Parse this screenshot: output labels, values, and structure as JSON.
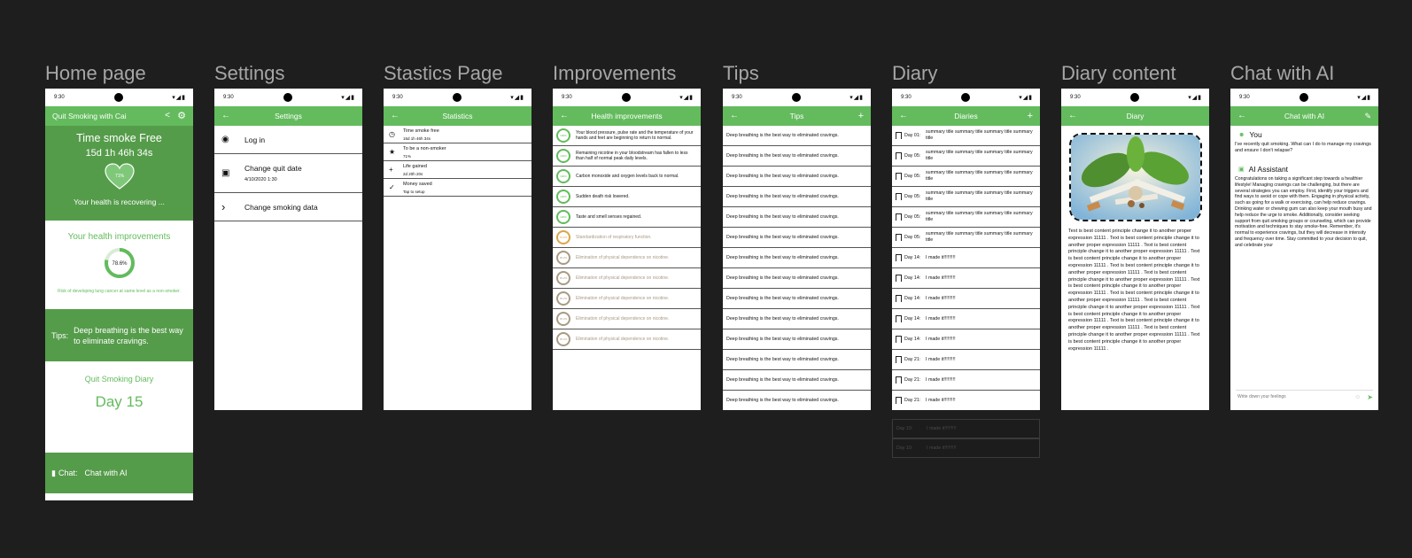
{
  "status": {
    "time": "9:30",
    "icons": "▾◢▮"
  },
  "frames": {
    "home": {
      "title": "Home page"
    },
    "settings": {
      "title": "Settings"
    },
    "stats": {
      "title": "Stastics Page"
    },
    "improvements": {
      "title": "Improvements"
    },
    "tips": {
      "title": "Tips"
    },
    "diary": {
      "title": "Diary"
    },
    "diary_content": {
      "title": "Diary content"
    },
    "chat": {
      "title": "Chat with AI"
    }
  },
  "home": {
    "app_title": "Quit Smoking with Cai",
    "smoke_free_label": "Time smoke Free",
    "smoke_free_time": "15d 1h 46h 34s",
    "heart_percent": "71%",
    "recovering": "Your health is recovering ...",
    "improvements_title": "Your health improvements",
    "improvement_percent": "78.6%",
    "improvement_progress": 0.786,
    "improvement_caption": "Risk of developing lung cancer at same level as a non-smoker.",
    "tips_label": "Tips:",
    "tips_text": "Deep breathing is the best way to eliminate cravings.",
    "diary_title": "Quit Smoking Diary",
    "diary_day": "Day 15",
    "chat_label": "Chat:",
    "chat_link": "Chat with AI"
  },
  "settings": {
    "title": "Settings",
    "items": [
      {
        "label": "Log in",
        "sub": "",
        "icon": "account-circle-icon",
        "glyph": "◉"
      },
      {
        "label": "Change quit date",
        "sub": "4/10/2020 1:30",
        "icon": "calendar-icon",
        "glyph": "▣"
      },
      {
        "label": "Change smoking data",
        "sub": "",
        "icon": "chevron-right-icon",
        "glyph": "›"
      }
    ]
  },
  "stats": {
    "title": "Statistics",
    "items": [
      {
        "label": "Time smoke free",
        "sub": "15d 1h 46h 34s",
        "icon": "clock-icon",
        "glyph": "◷"
      },
      {
        "label": "To be a non-smoker",
        "sub": "71%",
        "icon": "star-icon",
        "glyph": "★"
      },
      {
        "label": "Life gained",
        "sub": "2d 20h 20s",
        "icon": "plus-icon",
        "glyph": "+"
      },
      {
        "label": "Money saved",
        "sub": "Tap to setup",
        "icon": "check-icon",
        "glyph": "✓"
      }
    ]
  },
  "improvements": {
    "title": "Health improvements",
    "items": [
      {
        "text": "Your blood pressure, pulse rate and the temperature of your hands and feet are beginning to return to normal.",
        "pct": "100%",
        "state": "done"
      },
      {
        "text": "Remaining nicotine in your bloodstream has fallen to less than half of normal peak daily levels.",
        "pct": "100%",
        "state": "done"
      },
      {
        "text": "Carbon monoxide and oxygen levels back to normal.",
        "pct": "100%",
        "state": "done"
      },
      {
        "text": "Sudden death risk lowered.",
        "pct": "100%",
        "state": "done"
      },
      {
        "text": "Taste and smell senses regained.",
        "pct": "100%",
        "state": "done"
      },
      {
        "text": "Standardization of respiratory function.",
        "pct": "75.2%",
        "state": "progress"
      },
      {
        "text": "Elimination of physical dependence on nicotine.",
        "pct": "35.2%",
        "state": "pending"
      },
      {
        "text": "Elimination of physical dependence on nicotine.",
        "pct": "35.2%",
        "state": "pending"
      },
      {
        "text": "Elimination of physical dependence on nicotine.",
        "pct": "35.2%",
        "state": "pending"
      },
      {
        "text": "Elimination of physical dependence on nicotine.",
        "pct": "35.2%",
        "state": "pending"
      },
      {
        "text": "Elimination of physical dependence on nicotine.",
        "pct": "35.2%",
        "state": "pending"
      }
    ]
  },
  "tips": {
    "title": "Tips",
    "items": [
      "Deep breathing is the best way to eliminated cravings.",
      "Deep breathing is the best way to eliminated cravings.",
      "Deep breathing is the best way to eliminated cravings.",
      "Deep breathing is the best way to eliminated cravings.",
      "Deep breathing is the best way to eliminated cravings.",
      "Deep breathing is the best way to eliminated cravings.",
      "Deep breathing is the best way to eliminated cravings.",
      "Deep breathing is the best way to eliminated cravings.",
      "Deep breathing is the best way to eliminated cravings.",
      "Deep breathing is the best way to eliminated cravings.",
      "Deep breathing is the best way to eliminated cravings.",
      "Deep breathing is the best way to eliminated cravings.",
      "Deep breathing is the best way to eliminated cravings.",
      "Deep breathing is the best way to eliminated cravings."
    ]
  },
  "diary": {
    "title": "Diaries",
    "items": [
      {
        "day": "Day 01:",
        "text": "summary title summary title summary title summary title"
      },
      {
        "day": "Day 05:",
        "text": "summary title summary title summary title summary title"
      },
      {
        "day": "Day 05:",
        "text": "summary title summary title summary title summary title"
      },
      {
        "day": "Day 05:",
        "text": "summary title summary title summary title summary title"
      },
      {
        "day": "Day 05:",
        "text": "summary title summary title summary title summary title"
      },
      {
        "day": "Day 05:",
        "text": "summary title summary title summary title summary title"
      },
      {
        "day": "Day 14:",
        "text": "I made it!!!!!!!!!"
      },
      {
        "day": "Day 14:",
        "text": "I made it!!!!!!!!!"
      },
      {
        "day": "Day 14:",
        "text": "I made it!!!!!!!!!"
      },
      {
        "day": "Day 14:",
        "text": "I made it!!!!!!!!!"
      },
      {
        "day": "Day 14:",
        "text": "I made it!!!!!!!!!"
      },
      {
        "day": "Day 21:",
        "text": "I made it!!!!!!!!!"
      },
      {
        "day": "Day 21:",
        "text": "I made it!!!!!!!!!"
      },
      {
        "day": "Day 21:",
        "text": "I made it!!!!!!!!!"
      }
    ],
    "overflow": [
      {
        "day": "Day 10:",
        "text": "I made it!!!!!!!!!"
      },
      {
        "day": "Day 10:",
        "text": "I made it!!!!!!!!!"
      }
    ]
  },
  "diary_content": {
    "title": "Diary",
    "body": "Text is best content principle change it to another proper expression 11111 . Text is best content principle change it to another proper expression 11111 . Text is best content principle change it to another proper expression 11111 . Text is best content principle change it to another proper expression 11111 . Text is best content principle change it to another proper expression 11111 . Text is best content principle change it to another proper expression 11111 . Text is best content principle change it to another proper expression 11111 . Text is best content principle change it to another proper expression 11111 . Text is best content principle change it to another proper expression 11111 . Text is best content principle change it to another proper expression 11111 . Text is best content principle change it to another proper expression 11111 . Text is best content principle change it to another proper expression 11111 . Text is best content principle change it to another proper expression 11111 ."
  },
  "chat": {
    "title": "Chat with AI",
    "user_name": "You",
    "user_msg": "I've recently quit smoking. What can I do to manage my cravings and ensure I don't relapse?",
    "ai_name": "AI Assistant",
    "ai_msg": "Congratulations on taking a significant step towards a healthier lifestyle! Managing cravings can be challenging, but there are several strategies you can employ. First, identify your triggers and find ways to avoid or cope with them. Engaging in physical activity, such as going for a walk or exercising, can help reduce cravings. Drinking water or chewing gum can also keep your mouth busy and help reduce the urge to smoke. Additionally, consider seeking support from quit smoking groups or counseling, which can provide motivation and techniques to stay smoke-free. Remember, it's normal to experience cravings, but they will decrease in intensity and frequency over time. Stay committed to your decision to quit, and celebrate your",
    "input_placeholder": "Write down your feelings"
  },
  "colors": {
    "accent": "#63bb5d",
    "accent_dark": "#559c4a",
    "pending": "#a89a84",
    "progress": "#d9a64a"
  }
}
